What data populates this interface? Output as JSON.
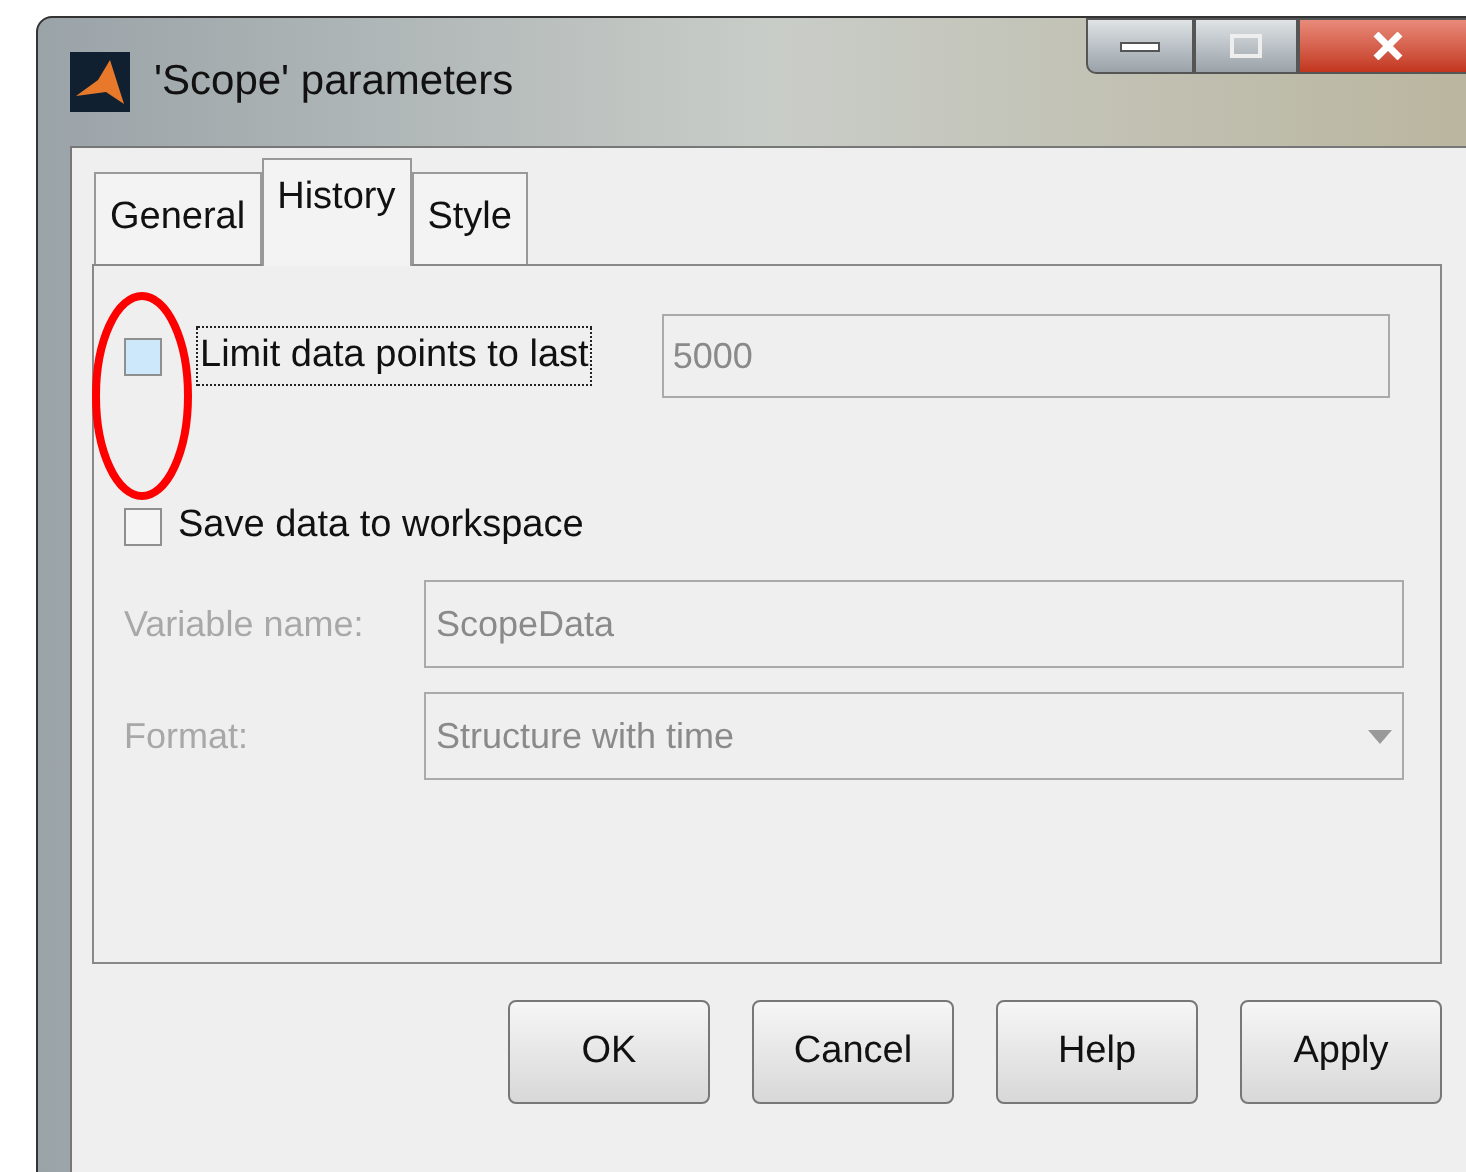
{
  "window": {
    "title": "'Scope' parameters"
  },
  "tabs": [
    {
      "label": "General",
      "selected": false
    },
    {
      "label": "History",
      "selected": true
    },
    {
      "label": "Style",
      "selected": false
    }
  ],
  "limit": {
    "label": "Limit data points to last",
    "checked": false,
    "focused": true,
    "value": "5000",
    "disabled": true
  },
  "save": {
    "label": "Save data to workspace",
    "checked": false
  },
  "fields": [
    {
      "kind": "text",
      "label": "Variable name:",
      "value": "ScopeData",
      "disabled": true
    },
    {
      "kind": "select",
      "label": "Format:",
      "value": "Structure with time",
      "disabled": true
    }
  ],
  "annotation": {
    "kind": "ellipse",
    "color": "#ff0000"
  },
  "buttons": [
    "OK",
    "Cancel",
    "Help",
    "Apply"
  ]
}
